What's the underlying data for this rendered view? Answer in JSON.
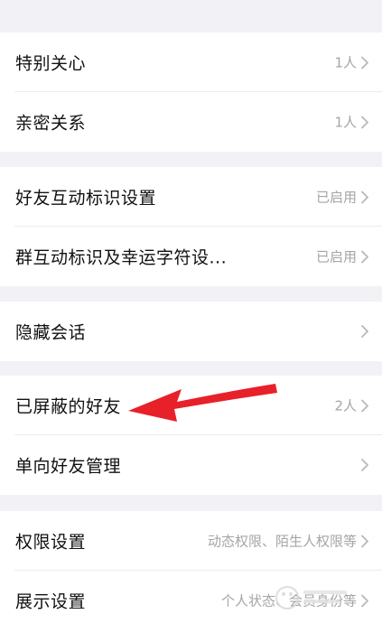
{
  "sections": [
    {
      "rows": [
        {
          "label": "特别关心",
          "value": "1人"
        },
        {
          "label": "亲密关系",
          "value": "1人"
        }
      ]
    },
    {
      "rows": [
        {
          "label": "好友互动标识设置",
          "value": "已启用"
        },
        {
          "label": "群互动标识及幸运字符设...",
          "value": "已启用"
        }
      ]
    },
    {
      "rows": [
        {
          "label": "隐藏会话",
          "value": ""
        }
      ]
    },
    {
      "rows": [
        {
          "label": "已屏蔽的好友",
          "value": "2人"
        },
        {
          "label": "单向好友管理",
          "value": ""
        }
      ]
    },
    {
      "rows": [
        {
          "label": "权限设置",
          "value": "动态权限、陌生人权限等"
        },
        {
          "label": "展示设置",
          "value": "个人状态、会员身份等"
        }
      ]
    }
  ],
  "icons": {
    "row_chevron": "chevron-right-icon",
    "annotation": "red-arrow-annotation",
    "watermark": "baidu-watermark"
  },
  "colors": {
    "background": "#f2f2f6",
    "card": "#ffffff",
    "text": "#111111",
    "secondary": "#a5a5a5",
    "arrow": "#e8202a"
  }
}
